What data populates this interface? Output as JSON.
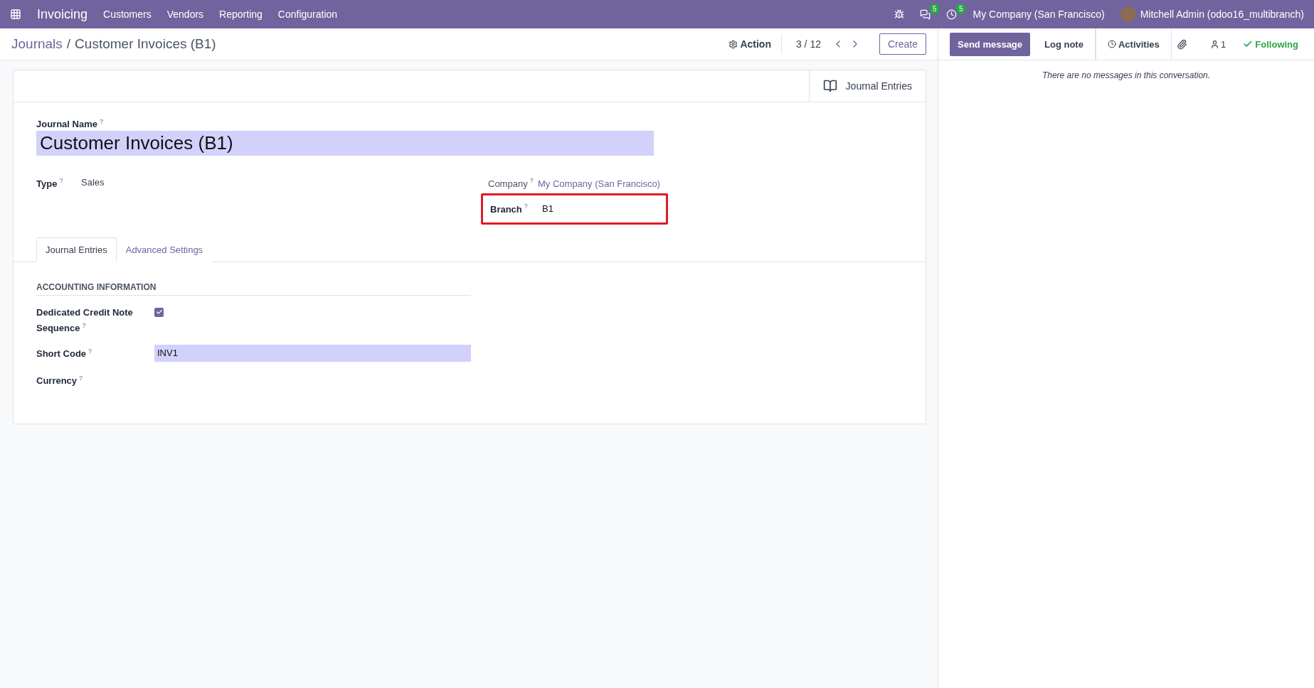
{
  "navbar": {
    "app": "Invoicing",
    "menu": [
      "Customers",
      "Vendors",
      "Reporting",
      "Configuration"
    ],
    "messages_count": "5",
    "activities_count": "5",
    "company": "My Company (San Francisco)",
    "user": "Mitchell Admin (odoo16_multibranch)"
  },
  "breadcrumb": {
    "parent": "Journals",
    "separator": "/",
    "current": "Customer Invoices (B1)"
  },
  "control": {
    "action": "Action",
    "pager": "3 / 12",
    "create": "Create"
  },
  "smart_button": "Journal Entries",
  "form": {
    "name_label": "Journal Name",
    "name_value": "Customer Invoices (B1)",
    "type_label": "Type",
    "type_value": "Sales",
    "company_label": "Company",
    "company_value": "My Company (San Francisco)",
    "branch_label": "Branch",
    "branch_value": "B1",
    "branch_highlighted": true,
    "help_mark": "?"
  },
  "tabs": [
    {
      "label": "Journal Entries",
      "selected": true
    },
    {
      "label": "Advanced Settings",
      "selected": false
    }
  ],
  "section": {
    "title": "ACCOUNTING INFORMATION",
    "fields": [
      {
        "kind": "checkbox",
        "label": "Dedicated Credit Note Sequence",
        "checked": true
      },
      {
        "kind": "input",
        "label": "Short Code",
        "value": "INV1"
      },
      {
        "kind": "empty",
        "label": "Currency"
      }
    ]
  },
  "chatter": {
    "send": "Send message",
    "log": "Log note",
    "activities": "Activities",
    "followers": "1",
    "following": "Following",
    "empty": "There are no messages in this conversation."
  }
}
